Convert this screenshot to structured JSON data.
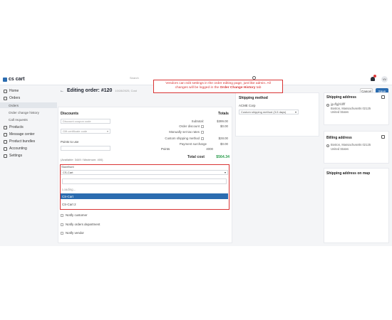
{
  "app": {
    "logo": "cs cart",
    "user_initials": "VV"
  },
  "search": {
    "placeholder": "Search"
  },
  "callout": {
    "line1": "Vendors can edit settings in the order editing page, just like admin. All",
    "line2_prefix": "changes will be logged in the ",
    "line2_bold": "Order Change History",
    "line2_suffix": " tab"
  },
  "sidebar": {
    "items": [
      {
        "label": "Home",
        "icon": "home-icon"
      },
      {
        "label": "Orders",
        "icon": "orders-icon"
      },
      {
        "label": "Orders",
        "sub": true,
        "active": true
      },
      {
        "label": "Order change history",
        "sub": true
      },
      {
        "label": "Call requests",
        "sub": true
      },
      {
        "label": "Products",
        "icon": "products-icon"
      },
      {
        "label": "Message center",
        "icon": "message-icon"
      },
      {
        "label": "Product bundles",
        "icon": "bundle-icon"
      },
      {
        "label": "Accounting",
        "icon": "accounting-icon"
      },
      {
        "label": "Settings",
        "icon": "gear-icon"
      }
    ]
  },
  "header": {
    "title": "Editing order: #120",
    "subtitle": "10/28/2025, Cost",
    "cancel": "Cancel",
    "save": "Save"
  },
  "discounts": {
    "heading": "Discounts",
    "coupon_placeholder": "Discount coupon code",
    "gift_placeholder": "Gift certificate code",
    "points_label": "Points to use",
    "points_hint": "(Available: 3449 / Maximum: 400)"
  },
  "totals": {
    "heading": "Totals",
    "rows": [
      {
        "label": "Subtotal:",
        "value": "$399.00"
      },
      {
        "label": "Order discount",
        "value": "$0.00"
      },
      {
        "label": "Manually set tax rates",
        "value": ""
      },
      {
        "label": "Custom shipping method",
        "value": "$28.00"
      },
      {
        "label": "Payment surcharge",
        "value": "$0.00"
      },
      {
        "label": "Points",
        "value": "4000"
      }
    ],
    "total_label": "Total cost",
    "total_value": "$564.34"
  },
  "shipping_method": {
    "heading": "Shipping method",
    "company": "ACME Corp",
    "selected": "Custom shipping method (3-5 days)"
  },
  "storefront": {
    "label": "Storefront",
    "selected": "CS-Cart",
    "loading": "Loading...",
    "options": [
      "CS-Cart",
      "CS-Cart 2"
    ]
  },
  "notify": [
    "Notify customer",
    "Notify orders department",
    "Notify vendor"
  ],
  "shipping_address": {
    "heading": "Shipping address",
    "lines": [
      "jguffgjhfdfff",
      "Boston, Massachusetts 02125",
      "United States"
    ]
  },
  "billing_address": {
    "heading": "Billing address",
    "lines": [
      "Boston, Massachusetts 02125",
      "United States"
    ]
  },
  "map": {
    "heading": "Shipping address on map"
  },
  "colors": {
    "accent": "#2b6cb0",
    "callout": "#d93434",
    "total": "#2e9e4f"
  }
}
